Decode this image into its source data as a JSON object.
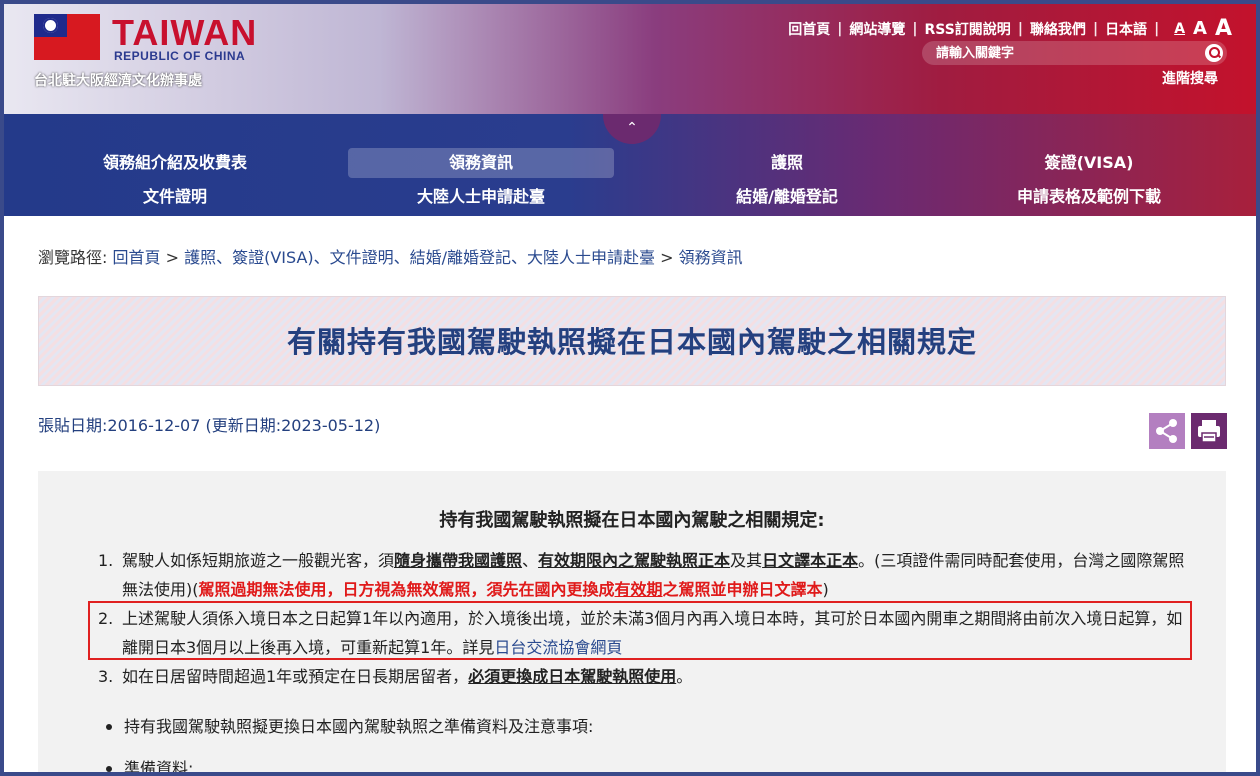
{
  "header": {
    "brand": "TAIWAN",
    "brand_sub": "REPUBLIC OF CHINA",
    "office": "台北駐大阪經濟文化辦事處",
    "links": [
      "回首頁",
      "網站導覽",
      "RSS訂閱說明",
      "聯絡我們",
      "日本語"
    ],
    "font_sizes": [
      "A",
      "A",
      "A"
    ],
    "search_placeholder": "請輸入關鍵字",
    "advanced_search": "進階搜尋"
  },
  "nav": {
    "toggle_icon": "chevron-updown-icon",
    "items": [
      "領務組介紹及收費表",
      "領務資訊",
      "護照",
      "簽證(VISA)",
      "文件證明",
      "大陸人士申請赴臺",
      "結婚/離婚登記",
      "申請表格及範例下載"
    ]
  },
  "breadcrumb": {
    "label": "瀏覽路徑:",
    "home": "回首頁",
    "sep": ">",
    "section": "護照、簽證(VISA)、文件證明、結婚/離婚登記、大陸人士申請赴臺",
    "current": "領務資訊"
  },
  "page_title": "有關持有我國駕駛執照擬在日本國內駕駛之相關規定",
  "dates": "張貼日期:2016-12-07 (更新日期:2023-05-12)",
  "content": {
    "heading": "持有我國駕駛執照擬在日本國內駕駛之相關規定:",
    "item1": {
      "num": "1.",
      "t1": "駕駛人如係短期旅遊之一般觀光客，須",
      "u1": "隨身攜帶我國護照",
      "t2": "、",
      "u2": "有效期限內之駕駛執照正本",
      "t3": "及其",
      "u3": "日文譯本正本",
      "t4": "。(三項證件需同時配套使用，台灣之國際駕照無法使用)(",
      "r1": "駕照過期無法使用，日方視為無效駕照，須先在國內更換成",
      "ru": "有效期",
      "r2": "之駕照並申辦日文譯本",
      "t5": ")"
    },
    "item2": {
      "num": "2.",
      "text": "上述駕駛人須係入境日本之日起算1年以內適用，於入境後出境，並於未滿3個月內再入境日本時，其可於日本國內開車之期間將由前次入境日起算，如離開日本3個月以上後再入境，可重新起算1年。詳見",
      "link": "日台交流協會網頁"
    },
    "item3": {
      "num": "3.",
      "t1": "如在日居留時間超過1年或預定在日長期居留者，",
      "u1": "必須更換成日本駕駛執照使用",
      "t2": "。"
    },
    "bullets": [
      "持有我國駕駛執照擬更換日本國內駕駛執照之準備資料及注意事項:",
      "準備資料:"
    ]
  }
}
